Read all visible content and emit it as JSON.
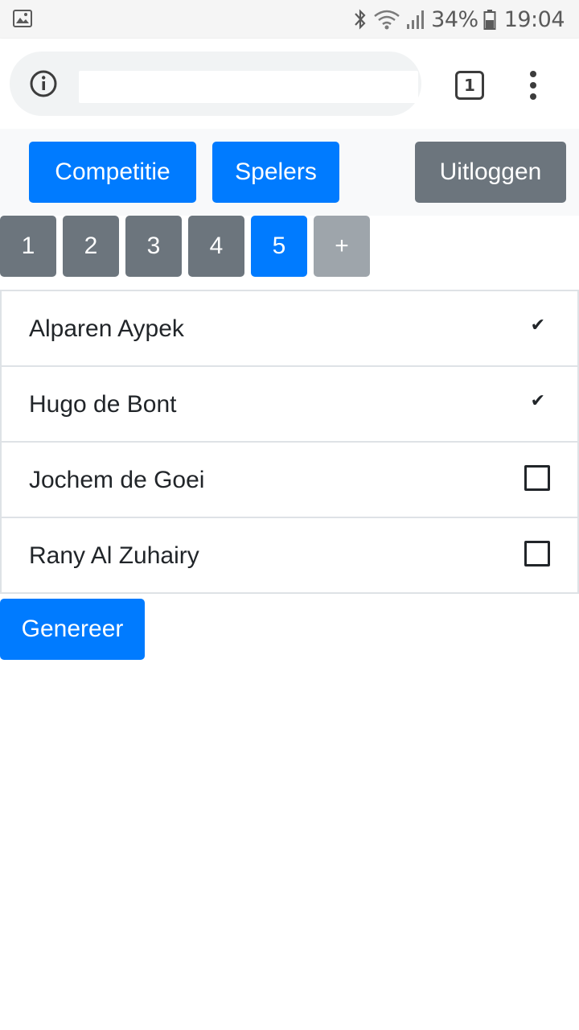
{
  "status_bar": {
    "battery_percent": "34%",
    "time": "19:04",
    "icons": [
      "gallery-icon",
      "bluetooth-icon",
      "wifi-icon",
      "signal-icon",
      "battery-icon"
    ]
  },
  "browser": {
    "url": "",
    "tab_count": "1",
    "icons": [
      "info-icon",
      "overflow-menu-icon"
    ]
  },
  "navbar": {
    "competitie": "Competitie",
    "spelers": "Spelers",
    "uitloggen": "Uitloggen"
  },
  "rounds": {
    "items": [
      "1",
      "2",
      "3",
      "4",
      "5"
    ],
    "active": "5",
    "add": "+"
  },
  "players": [
    {
      "name": "Alparen Aypek",
      "checked": true
    },
    {
      "name": "Hugo de Bont",
      "checked": true
    },
    {
      "name": "Jochem de Goei",
      "checked": false
    },
    {
      "name": "Rany Al Zuhairy",
      "checked": false
    }
  ],
  "generate_button": "Genereer",
  "colors": {
    "primary": "#007bff",
    "secondary": "#6c757d",
    "disabled": "#9ea5ab",
    "navbar_bg": "#f8f9fa"
  }
}
